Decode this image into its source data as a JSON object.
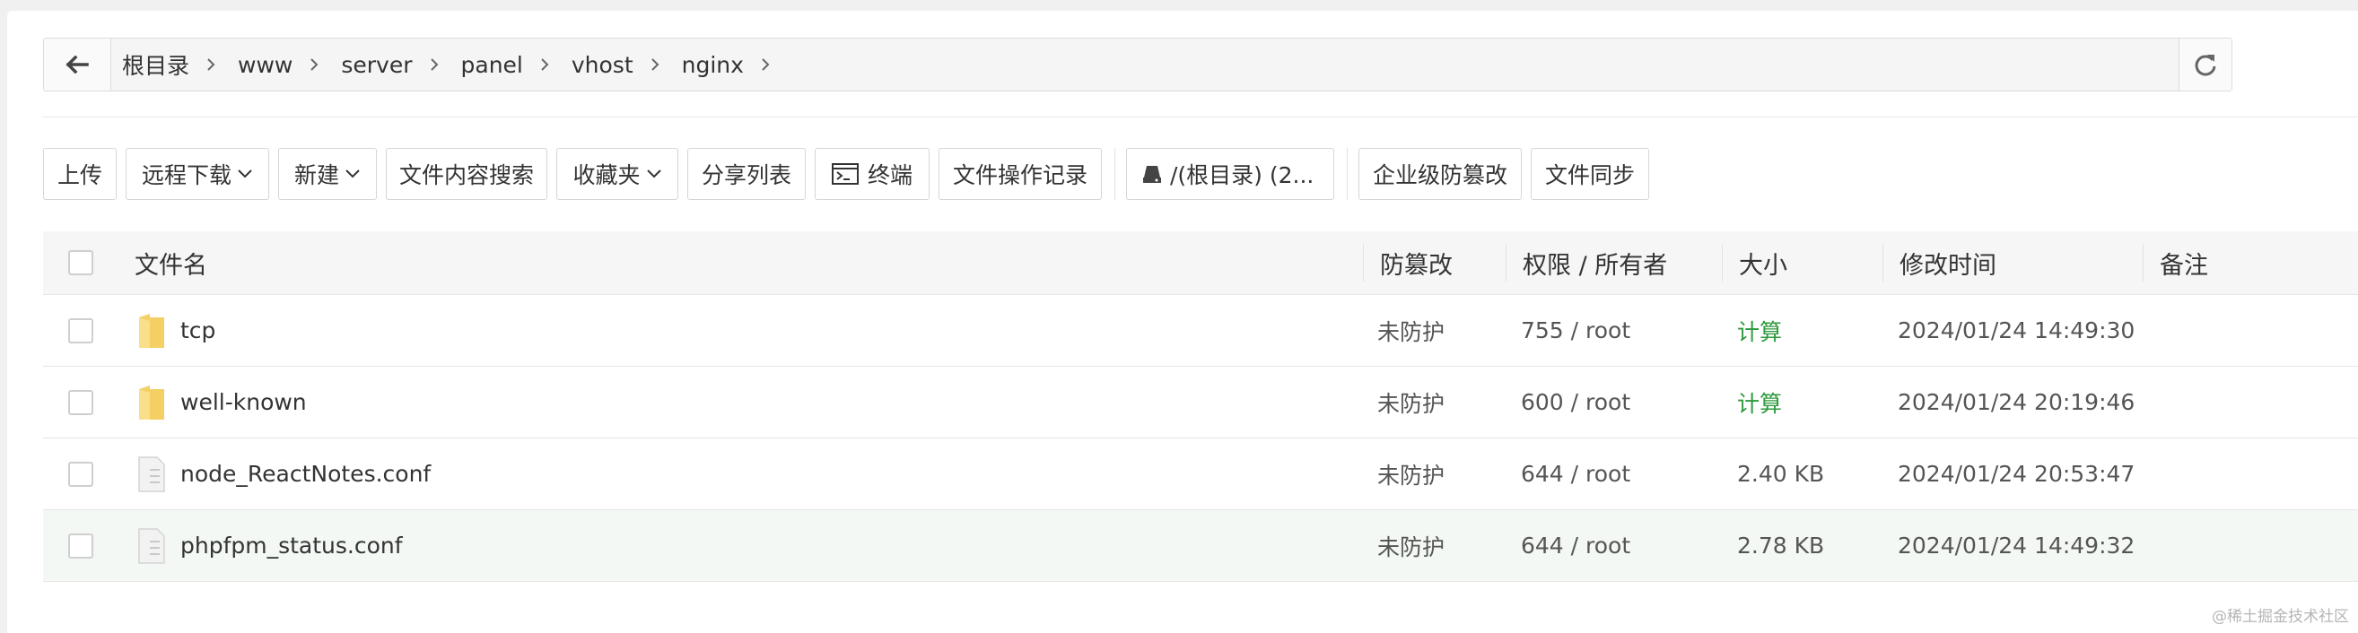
{
  "path": {
    "crumbs": [
      "根目录",
      "www",
      "server",
      "panel",
      "vhost",
      "nginx"
    ]
  },
  "toolbar": {
    "upload": "上传",
    "remote_download": "远程下载",
    "new": "新建",
    "content_search": "文件内容搜索",
    "favorites": "收藏夹",
    "share_list": "分享列表",
    "terminal": "终端",
    "operation_log": "文件操作记录",
    "disk": "/(根目录) (2...",
    "tamper_proof": "企业级防篡改",
    "file_sync": "文件同步"
  },
  "table": {
    "headers": {
      "name": "文件名",
      "tamper": "防篡改",
      "perm": "权限 / 所有者",
      "size": "大小",
      "mtime": "修改时间",
      "note": "备注"
    },
    "rows": [
      {
        "icon": "folder-icon",
        "name": "tcp",
        "tamper": "未防护",
        "perm": "755 / root",
        "size": "计算",
        "mtime": "2024/01/24 14:49:30"
      },
      {
        "icon": "folder-icon",
        "name": "well-known",
        "tamper": "未防护",
        "perm": "600 / root",
        "size": "计算",
        "mtime": "2024/01/24 20:19:46"
      },
      {
        "icon": "file-icon",
        "name": "node_ReactNotes.conf",
        "tamper": "未防护",
        "perm": "644 / root",
        "size": "2.40 KB",
        "mtime": "2024/01/24 20:53:47"
      },
      {
        "icon": "file-icon",
        "name": "phpfpm_status.conf",
        "tamper": "未防护",
        "perm": "644 / root",
        "size": "2.78 KB",
        "mtime": "2024/01/24 14:49:32"
      }
    ]
  },
  "watermark": "@稀土掘金技术社区",
  "colors": {
    "accent_green": "#2e9a3e",
    "folder": "#f7d774",
    "hover_row": "#f3f8f4"
  }
}
